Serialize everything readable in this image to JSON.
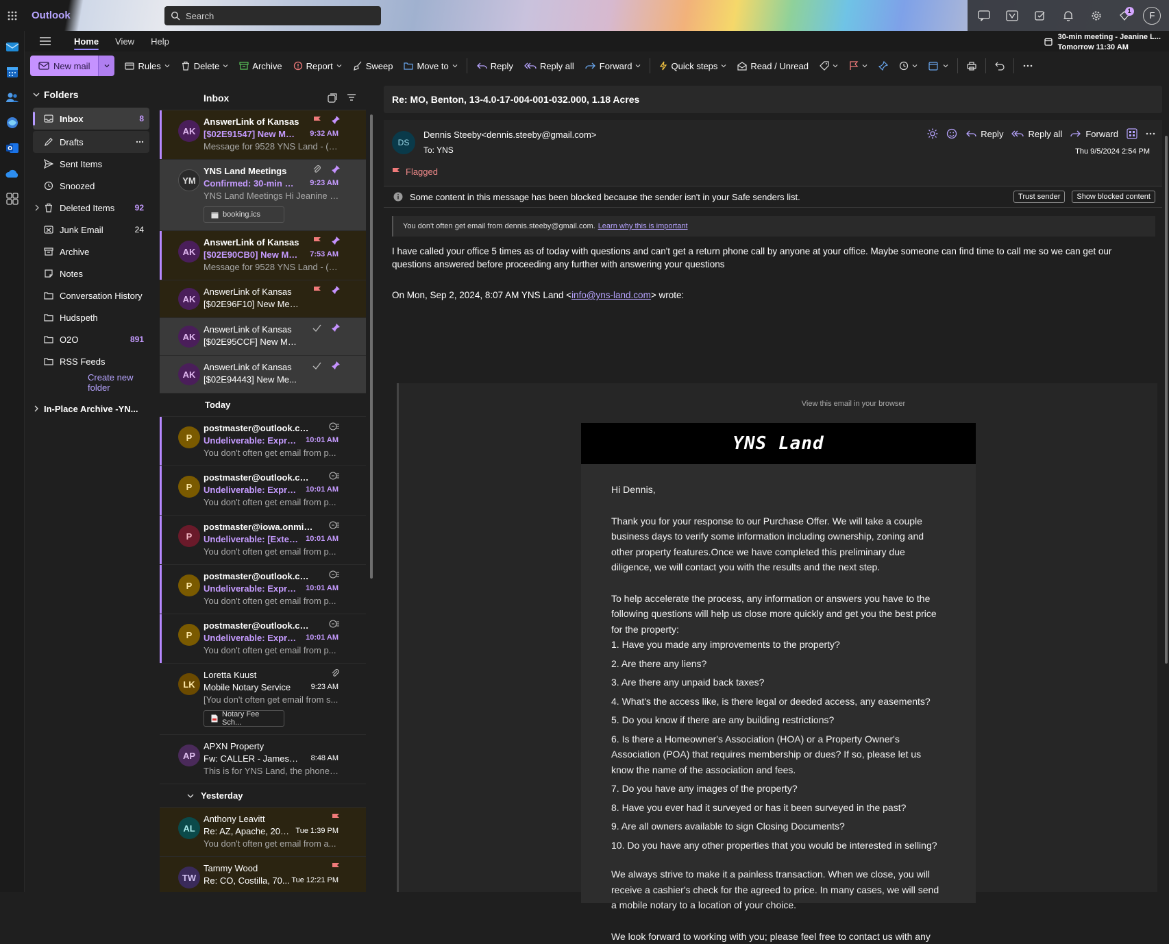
{
  "app": {
    "title": "Outlook"
  },
  "search": {
    "placeholder": "Search"
  },
  "topbar": {
    "notification_badge": "1",
    "profile_initial": "F"
  },
  "nav": {
    "tabs": [
      "Home",
      "View",
      "Help"
    ]
  },
  "reminder": {
    "title": "30-min meeting - Jeanine L...",
    "time": "Tomorrow 11:30 AM"
  },
  "ribbon": {
    "new_mail": "New mail",
    "rules": "Rules",
    "delete": "Delete",
    "archive": "Archive",
    "report": "Report",
    "sweep": "Sweep",
    "move_to": "Move to",
    "reply": "Reply",
    "reply_all": "Reply all",
    "forward": "Forward",
    "quick_steps": "Quick steps",
    "read_unread": "Read / Unread"
  },
  "folders": {
    "header": "Folders",
    "items": [
      {
        "label": "Inbox",
        "count": "8"
      },
      {
        "label": "Drafts",
        "count": ""
      },
      {
        "label": "Sent Items",
        "count": ""
      },
      {
        "label": "Snoozed",
        "count": ""
      },
      {
        "label": "Deleted Items",
        "count": "92"
      },
      {
        "label": "Junk Email",
        "count": "24"
      },
      {
        "label": "Archive",
        "count": ""
      },
      {
        "label": "Notes",
        "count": ""
      },
      {
        "label": "Conversation History",
        "count": ""
      },
      {
        "label": "Hudspeth",
        "count": ""
      },
      {
        "label": "O2O",
        "count": "891"
      },
      {
        "label": "RSS Feeds",
        "count": ""
      }
    ],
    "create": "Create new folder",
    "archive_group": "In-Place Archive -YN..."
  },
  "list": {
    "title": "Inbox",
    "groups": {
      "today": "Today",
      "yesterday": "Yesterday"
    },
    "pinned": [
      {
        "initials": "AK",
        "sender": "AnswerLink of Kansas",
        "subject": "[$02E91547] New Mes...",
        "time": "9:32 AM",
        "preview": "Message for 9528 YNS Land - (N..."
      },
      {
        "initials": "YM",
        "sender": "YNS Land Meetings",
        "subject": "Confirmed: 30-min me...",
        "time": "9:23 AM",
        "preview": "YNS Land Meetings Hi Jeanine La...",
        "attachment": "booking.ics"
      },
      {
        "initials": "AK",
        "sender": "AnswerLink of Kansas",
        "subject": "[$02E90CB0] New Mes...",
        "time": "7:53 AM",
        "preview": "Message for 9528 YNS Land - (N..."
      },
      {
        "initials": "AK",
        "sender": "AnswerLink of Kansas",
        "subject": "[$02E96F10] New Mes..."
      },
      {
        "initials": "AK",
        "sender": "AnswerLink of Kansas",
        "subject": "[$02E95CCF] New Me..."
      },
      {
        "initials": "AK",
        "sender": "AnswerLink of Kansas",
        "subject": "[$02E94443] New Me..."
      }
    ],
    "today": [
      {
        "initials": "P",
        "sender": "postmaster@outlook.com",
        "subject": "Undeliverable: Expres...",
        "time": "10:01 AM",
        "preview": "You don't often get email from p..."
      },
      {
        "initials": "P",
        "sender": "postmaster@outlook.com",
        "subject": "Undeliverable: Expres...",
        "time": "10:01 AM",
        "preview": "You don't often get email from p..."
      },
      {
        "initials": "P",
        "sender": "postmaster@iowa.onmicr...",
        "subject": "Undeliverable: [Extern...",
        "time": "10:01 AM",
        "preview": "You don't often get email from p..."
      },
      {
        "initials": "P",
        "sender": "postmaster@outlook.com",
        "subject": "Undeliverable: Expres...",
        "time": "10:01 AM",
        "preview": "You don't often get email from p..."
      },
      {
        "initials": "P",
        "sender": "postmaster@outlook.com",
        "subject": "Undeliverable: Expres...",
        "time": "10:01 AM",
        "preview": "You don't often get email from p..."
      },
      {
        "initials": "LK",
        "sender": "Loretta Kuust",
        "subject": "Mobile Notary Service",
        "time": "9:23 AM",
        "preview": "[You don't often get email from s...",
        "attachment": "Notary Fee Sch..."
      },
      {
        "initials": "AP",
        "sender": "APXN Property",
        "subject": "Fw: CALLER - James Ad...",
        "time": "8:48 AM",
        "preview": "This is for YNS Land, the phone n..."
      }
    ],
    "yesterday": [
      {
        "initials": "AL",
        "sender": "Anthony Leavitt",
        "subject": "Re: AZ, Apache, 205...",
        "time": "Tue 1:39 PM",
        "preview": "You don't often get email from a..."
      },
      {
        "initials": "TW",
        "sender": "Tammy Wood",
        "subject": "Re: CO, Costilla, 70...",
        "time": "Tue 12:21 PM",
        "preview": ""
      }
    ]
  },
  "reading": {
    "subject": "Re: MO, Benton, 13-4.0-17-004-001-032.000, 1.18 Acres",
    "avatar": "DS",
    "from": "Dennis Steeby<dennis.steeby@gmail.com>",
    "to_label": "To:",
    "to": "YNS",
    "actions": {
      "reply": "Reply",
      "reply_all": "Reply all",
      "forward": "Forward"
    },
    "date": "Thu 9/5/2024 2:54 PM",
    "flag": "Flagged",
    "blocked_msg": "Some content in this message has been blocked because the sender isn't in your Safe senders list.",
    "trust_sender": "Trust sender",
    "show_blocked": "Show blocked content",
    "notice_text": "You don't often get email from dennis.steeby@gmail.com.",
    "notice_link": "Learn why this is important",
    "body": "I have called your office 5 times as of today with questions and can't get a return phone call by anyone at your office.  Maybe someone can find time to call me so we can get our questions answered before proceeding any further with answering your questions",
    "quote_prefix": "On Mon, Sep 2, 2024, 8:07 AM YNS Land <",
    "quote_email": "info@yns-land.com",
    "quote_suffix": "> wrote:",
    "view_browser": "View this email in your browser",
    "brand": "YNS  Land",
    "greeting": "Hi Dennis,",
    "para1": "Thank you for your response to our Purchase Offer. We will take a couple business days to verify some information including ownership, zoning and other property features.Once we have completed this preliminary due diligence, we will contact you with the results and the next step.",
    "para2": "To help accelerate the process, any information or answers you have to the following questions will help us close more quickly and get you the best price for the property:",
    "questions": [
      "1.  Have you made any improvements to the property?",
      "2.  Are there any liens?",
      "3.  Are there any unpaid back taxes?",
      "4.  What's the access like, is there legal or deeded access, any easements?",
      "5.  Do you know if there are any building restrictions?",
      "6.  Is there a Homeowner's Association (HOA) or a Property Owner's Association (POA) that requires membership or dues? If so, please let us know the name of the association and fees.",
      "7.  Do you have any images of the property?",
      "8.  Have you ever had it surveyed or has it been surveyed in the past?",
      "9.  Are all owners available to sign Closing Documents?",
      "10.  Do you have any other properties that you would be interested in selling?"
    ],
    "para3": "We always strive to make it a painless transaction. When we close, you will receive a cashier's check for the agreed to price. In many cases, we will send a mobile notary to a location of your choice.",
    "para4": "We look forward to working with you; please feel free to contact us with any"
  },
  "colors": {
    "accent": "#c592ff",
    "flag": "#f07a7a",
    "pin": "#c592ff"
  }
}
